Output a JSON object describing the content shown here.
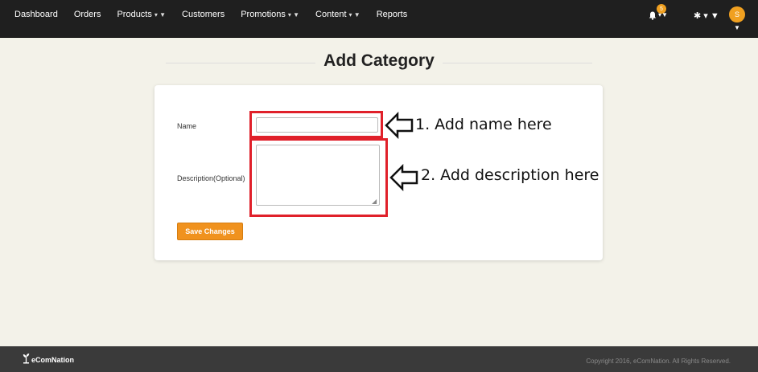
{
  "nav": {
    "items": [
      {
        "label": "Dashboard",
        "caret": ""
      },
      {
        "label": "Orders",
        "caret": ""
      },
      {
        "label": "Products",
        "caret": "▾ ▼"
      },
      {
        "label": "Customers",
        "caret": ""
      },
      {
        "label": "Promotions",
        "caret": "▾ ▼"
      },
      {
        "label": "Content",
        "caret": "▾ ▼"
      },
      {
        "label": "Reports",
        "caret": ""
      }
    ],
    "notification_count": "5",
    "avatar_initial": "S",
    "accent_color": "#f0a020"
  },
  "page": {
    "title": "Add Category"
  },
  "form": {
    "name_label": "Name",
    "name_value": "",
    "description_label": "Description(Optional)",
    "description_value": "",
    "save_label": "Save Changes"
  },
  "annotations": {
    "step1": "1. Add name here",
    "step2": "2. Add description here",
    "highlight_color": "#e0202a"
  },
  "footer": {
    "brand": "eComNation",
    "copyright": "Copyright 2016, eComNation. All Rights Reserved."
  }
}
